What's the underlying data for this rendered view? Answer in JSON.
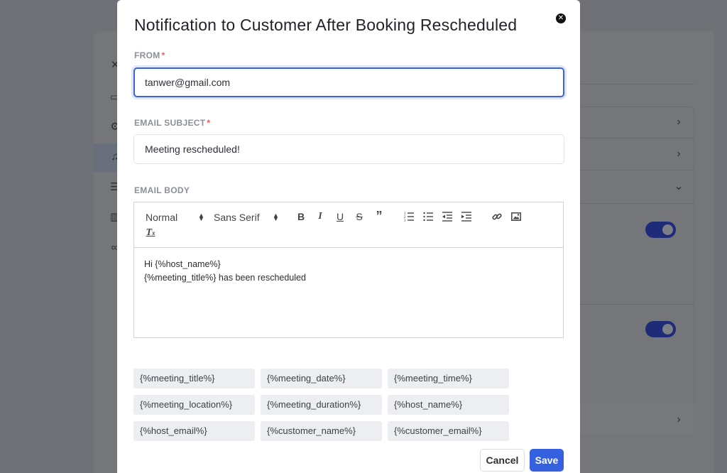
{
  "modal": {
    "title": "Notification to Customer After Booking Rescheduled",
    "close_icon": "close-icon",
    "from": {
      "label": "FROM",
      "required_mark": "*",
      "value": "tanwer@gmail.com"
    },
    "subject": {
      "label": "EMAIL SUBJECT",
      "required_mark": "*",
      "value": "Meeting rescheduled!"
    },
    "body": {
      "label": "EMAIL BODY",
      "toolbar": {
        "format_select": "Normal",
        "font_select": "Sans Serif",
        "buttons": [
          "bold-icon",
          "italic-icon",
          "underline-icon",
          "strikethrough-icon",
          "blockquote-icon",
          "ordered-list-icon",
          "bullet-list-icon",
          "outdent-icon",
          "indent-icon",
          "link-icon",
          "image-icon",
          "clear-format-icon"
        ]
      },
      "lines": [
        "Hi {%host_name%}",
        "{%meeting_title%} has been rescheduled"
      ]
    },
    "tags": [
      "{%meeting_title%}",
      "{%meeting_date%}",
      "{%meeting_time%}",
      "{%meeting_location%}",
      "{%meeting_duration%}",
      "{%host_name%}",
      "{%host_email%}",
      "{%customer_name%}",
      "{%customer_email%}"
    ],
    "cancel_label": "Cancel",
    "save_label": "Save"
  },
  "colors": {
    "accent": "#3560e0",
    "required": "#ee5a5a",
    "overlay": "#6f7176",
    "toggle_on": "#1e2b78"
  }
}
